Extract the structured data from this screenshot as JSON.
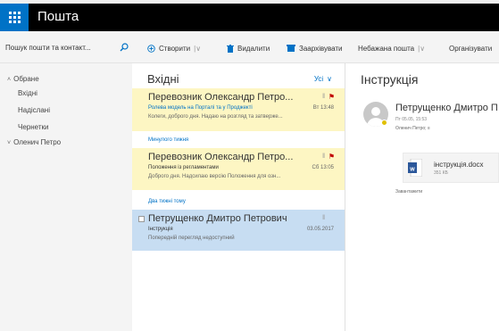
{
  "app": {
    "title": "Пошта"
  },
  "search": {
    "placeholder": "Пошук пошти та контакт..."
  },
  "toolbar": {
    "new_label": "Створити",
    "delete_label": "Видалити",
    "archive_label": "Заархівувати",
    "junk_label": "Небажана пошта",
    "organize_label": "Організувати"
  },
  "nav": {
    "favorites_label": "Обране",
    "items": [
      "Вхідні",
      "Надіслані",
      "Чернетки"
    ],
    "account_label": "Оленич Петро"
  },
  "list": {
    "title": "Вхідні",
    "filter_label": "Усі",
    "messages": [
      {
        "sender": "Перевозник Олександр Петро...",
        "subject": "Ролева модель на Порталі та у Проджекті",
        "time": "Вт 13:48",
        "preview": "Колеги, доброго дня. Надаю на розгляд та затверже..."
      },
      {
        "sender": "Перевозник Олександр Петро...",
        "subject": "Положення із регламентами",
        "time": "Сб 13:05",
        "preview": "Доброго дня. Надсилаю версію Положення для озн..."
      },
      {
        "sender": "Петрущенко Дмитро Петрович",
        "subject": "Інструкція",
        "time": "03.05.2017",
        "preview": "Попередній перегляд недоступний"
      }
    ],
    "group_last_week": "Минулого тижня",
    "group_two_weeks": "Два тижні тому"
  },
  "reading": {
    "title": "Інструкція",
    "sender": "Петрущенко Дмитро П",
    "date": "Пт 05.05, 15:53",
    "to": "Оленич Петро; ≡",
    "attachment_name": "інструкція.docx",
    "attachment_size": "351 КБ",
    "download_label": "Завантажити"
  },
  "colors": {
    "accent": "#0072c6",
    "flagged_bg": "#fdf6c3",
    "selected_bg": "#c7ddf2",
    "flag": "#c00000"
  }
}
